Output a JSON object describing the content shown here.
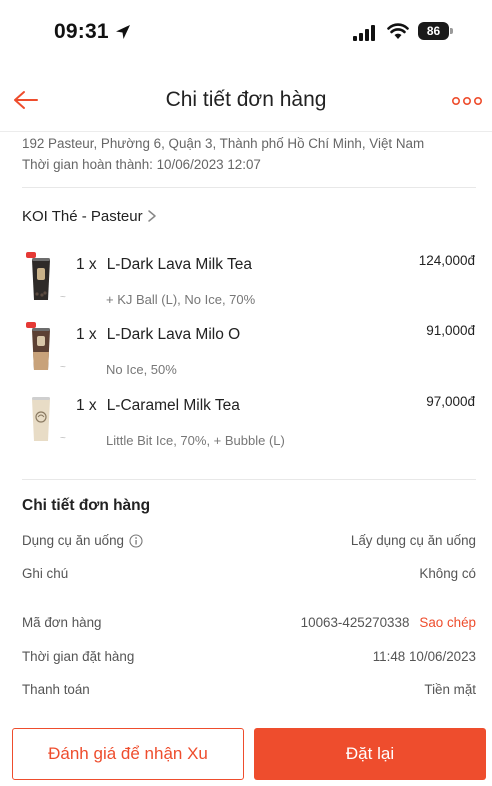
{
  "status_bar": {
    "time": "09:31",
    "battery": "86",
    "icons": [
      "location-arrow-icon",
      "signal-icon",
      "wifi-icon",
      "battery-icon"
    ]
  },
  "header": {
    "title": "Chi tiết đơn hàng",
    "back_icon": "back-arrow-icon",
    "more_icon": "more-icon"
  },
  "delivery": {
    "address": "192 Pasteur, Phường 6, Quận 3, Thành phố Hồ Chí Minh, Việt Nam",
    "completed_time": "Thời gian hoàn thành: 10/06/2023 12:07"
  },
  "store": {
    "name": "KOI Thé - Pasteur"
  },
  "items": [
    {
      "qty": "1 x",
      "name": "L-Dark Lava Milk Tea",
      "price": "124,000đ",
      "options": "+ KJ Ball (L), No Ice, 70%"
    },
    {
      "qty": "1 x",
      "name": "L-Dark Lava Milo O",
      "price": "91,000đ",
      "options": "No Ice, 50%"
    },
    {
      "qty": "1 x",
      "name": "L-Caramel Milk Tea",
      "price": "97,000đ",
      "options": "Little Bit Ice, 70%, + Bubble (L)"
    }
  ],
  "details": {
    "title": "Chi tiết đơn hàng",
    "utensils_label": "Dụng cụ ăn uống",
    "utensils_value": "Lấy dụng cụ ăn uống",
    "note_label": "Ghi chú",
    "note_value": "Không có",
    "order_id_label": "Mã đơn hàng",
    "order_id_value": "10063-425270338",
    "copy_label": "Sao chép",
    "order_time_label": "Thời gian đặt hàng",
    "order_time_value": "11:48 10/06/2023",
    "payment_label": "Thanh toán",
    "payment_value": "Tiền mặt"
  },
  "actions": {
    "rate_label": "Đánh giá để nhận Xu",
    "reorder_label": "Đặt lại"
  },
  "colors": {
    "accent": "#ee4d2d",
    "text": "#222222",
    "muted": "#777777"
  }
}
